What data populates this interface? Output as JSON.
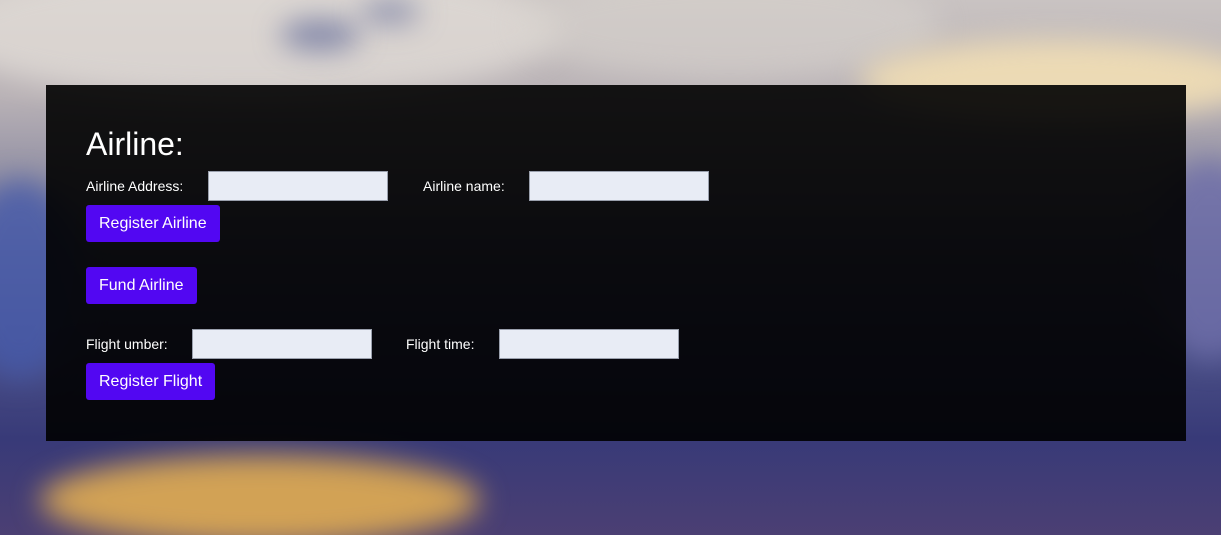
{
  "airline_section": {
    "title": "Airline:",
    "address_label": "Airline Address:",
    "address_value": "",
    "name_label": "Airline name:",
    "name_value": "",
    "register_button": "Register Airline",
    "fund_button": "Fund Airline"
  },
  "flight_section": {
    "number_label": "Flight umber:",
    "number_value": "",
    "time_label": "Flight time:",
    "time_value": "",
    "register_button": "Register Flight"
  },
  "colors": {
    "panel_background": "#000000",
    "button_background": "#5207f2",
    "button_text": "#ffffff",
    "input_background": "#e8ecf5",
    "label_text": "#ffffff"
  }
}
